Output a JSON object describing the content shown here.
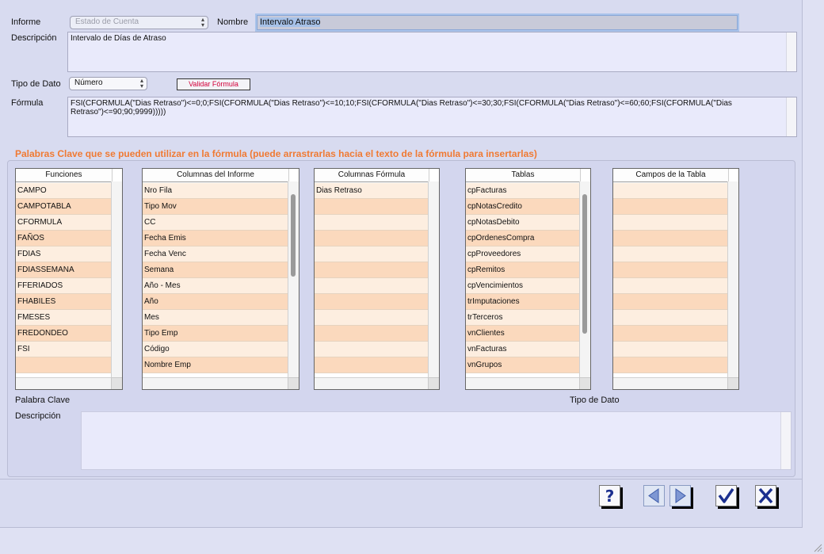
{
  "form": {
    "informe_label": "Informe",
    "informe_value": "Estado de Cuenta",
    "nombre_label": "Nombre",
    "nombre_value": "Intervalo Atraso",
    "descripcion_label": "Descripción",
    "descripcion_value": "Intervalo de Días de Atraso",
    "tipo_dato_label": "Tipo de Dato",
    "tipo_dato_value": "Número",
    "validar_label": "Validar Fórmula",
    "formula_label": "Fórmula",
    "formula_line1": "FSI(CFORMULA(\"Dias Retraso\")<=0;0;FSI(CFORMULA(\"Dias Retraso\")<=10;10;FSI(CFORMULA(\"Dias Retraso\")<=30;30;FSI(CFORMULA(\"Dias Retraso\")<=60;60;FSI(CFORMULA(\"Dias",
    "formula_line2": "Retraso\")<=90;90;9999)))))"
  },
  "keywords": {
    "title": "Palabras Clave que se pueden utilizar en la fórmula (puede arrastrarlas hacia el texto de la fórmula para insertarlas)",
    "funciones": {
      "header": "Funciones",
      "items": [
        "CAMPO",
        "CAMPOTABLA",
        "CFORMULA",
        "FAÑOS",
        "FDIAS",
        "FDIASSEMANA",
        "FFERIADOS",
        "FHABILES",
        "FMESES",
        "FREDONDEO",
        "FSI"
      ]
    },
    "columnas_informe": {
      "header": "Columnas del Informe",
      "items": [
        "Nro Fila",
        "Tipo Mov",
        "CC",
        "Fecha Emis",
        "Fecha Venc",
        "Semana",
        "Año - Mes",
        "Año",
        "Mes",
        "Tipo Emp",
        "Código",
        "Nombre Emp"
      ]
    },
    "columnas_formula": {
      "header": "Columnas Fórmula",
      "items": [
        "Dias Retraso"
      ]
    },
    "tablas": {
      "header": "Tablas",
      "items": [
        "cpFacturas",
        "cpNotasCredito",
        "cpNotasDebito",
        "cpOrdenesCompra",
        "cpProveedores",
        "cpRemitos",
        "cpVencimientos",
        "trImputaciones",
        "trTerceros",
        "vnClientes",
        "vnFacturas",
        "vnGrupos"
      ]
    },
    "campos_tabla": {
      "header": "Campos de la Tabla",
      "items": []
    },
    "palabra_clave_label": "Palabra Clave",
    "tipo_dato_label": "Tipo de Dato",
    "descripcion_label": "Descripción"
  },
  "toolbar": {
    "help_icon": "question-mark-icon",
    "prev_icon": "arrow-left-icon",
    "next_icon": "arrow-right-icon",
    "accept_icon": "check-icon",
    "cancel_icon": "x-icon"
  }
}
